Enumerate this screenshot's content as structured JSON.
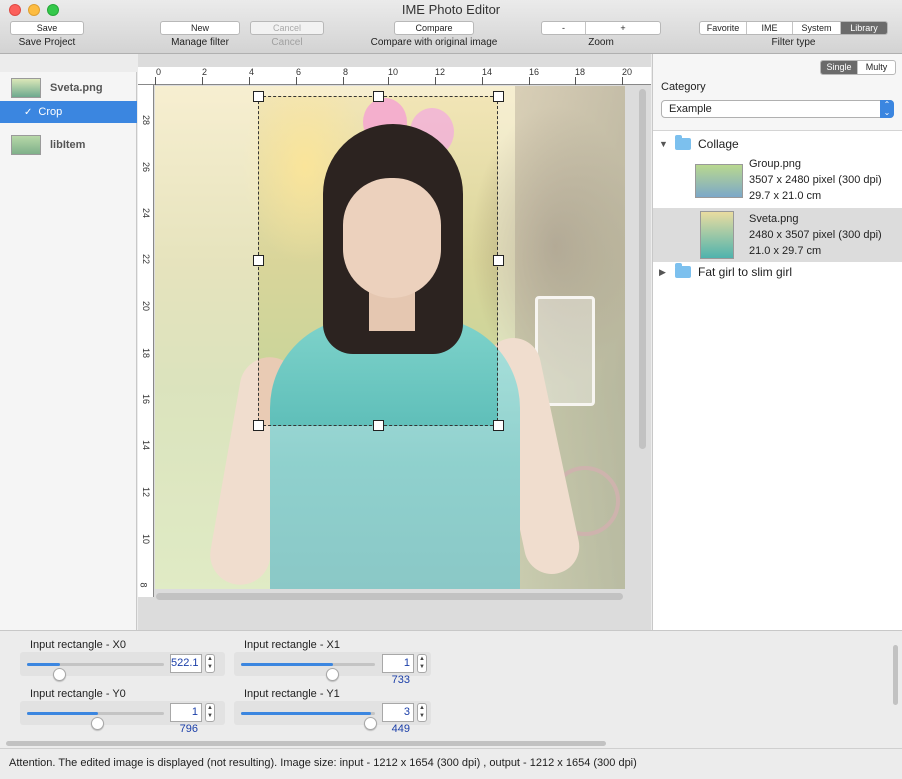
{
  "window": {
    "title": "IME Photo Editor"
  },
  "toolbar": {
    "save_button": "Save",
    "save_label": "Save Project",
    "new_button": "New",
    "cancel_button": "Cancel",
    "manage_filter_label": "Manage filter",
    "cancel_label": "Cancel",
    "compare_button": "Compare",
    "compare_label": "Compare with original image",
    "zoom_minus": "-",
    "zoom_plus": "+",
    "zoom_label": "Zoom",
    "filter_types": [
      "Favorite",
      "IME",
      "System",
      "Library"
    ],
    "filter_type_selected": "Library",
    "filter_type_label": "Filter type"
  },
  "left_panel": {
    "items": [
      {
        "label": "Sveta.png"
      },
      {
        "label": "Crop",
        "checked": true,
        "selected": true
      },
      {
        "label": "libItem"
      }
    ]
  },
  "rulers": {
    "top": [
      "0",
      "2",
      "4",
      "6",
      "8",
      "10",
      "12",
      "14",
      "16",
      "18",
      "20"
    ],
    "left": [
      "28",
      "26",
      "24",
      "22",
      "20",
      "18",
      "16",
      "14",
      "12",
      "10",
      "8"
    ]
  },
  "right_panel": {
    "view_modes": [
      "Single",
      "Multy"
    ],
    "view_mode_selected": "Single",
    "category_label": "Category",
    "category_value": "Example",
    "tree": {
      "folders": [
        {
          "name": "Collage",
          "expanded": true,
          "files": [
            {
              "name": "Group.png",
              "size": "3507 x 2480 pixel (300 dpi)",
              "dims": "29.7 x 21.0 cm",
              "selected": false
            },
            {
              "name": "Sveta.png",
              "size": "2480 x 3507 pixel (300 dpi)",
              "dims": "21.0 x 29.7 cm",
              "selected": true
            }
          ]
        },
        {
          "name": "Fat girl to slim girl",
          "expanded": false
        }
      ]
    }
  },
  "controls": {
    "x0": {
      "label": "Input rectangle - X0",
      "value": "522.1",
      "fraction": 0.24
    },
    "x1": {
      "label": "Input rectangle - X1",
      "value": "1 733",
      "fraction": 0.69
    },
    "y0": {
      "label": "Input rectangle - Y0",
      "value": "1 796",
      "fraction": 0.52
    },
    "y1": {
      "label": "Input rectangle - Y1",
      "value": "3 449",
      "fraction": 0.97
    }
  },
  "status": {
    "text": "Attention. The edited image is displayed (not resulting).  Image size: input - 1212 x 1654 (300 dpi) , output - 1212 x 1654 (300 dpi)"
  },
  "colors": {
    "accent": "#3b86e0",
    "selected_segment": "#6b6b6b"
  }
}
